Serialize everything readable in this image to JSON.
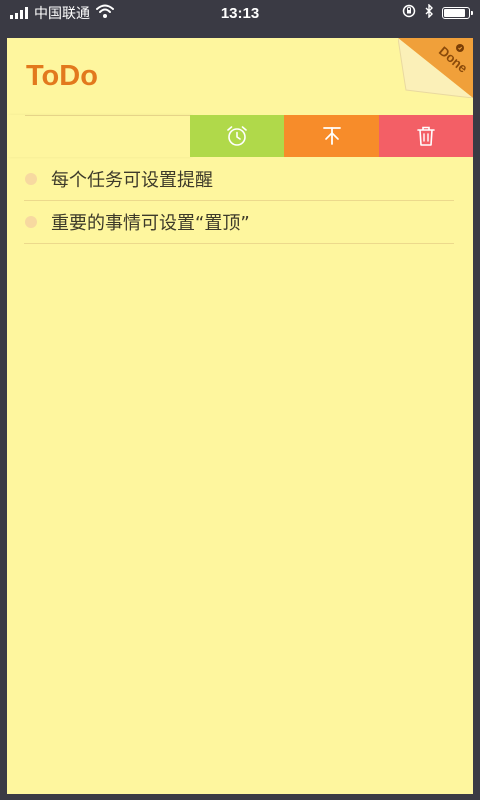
{
  "status_bar": {
    "carrier": "中国联通",
    "time": "13:13",
    "signal_icon": "signal-bars-icon",
    "wifi_icon": "wifi-icon",
    "orientation_lock_icon": "orientation-lock-icon",
    "bluetooth_icon": "bluetooth-icon",
    "battery_icon": "battery-icon"
  },
  "header": {
    "title": "ToDo",
    "done_label": "Done"
  },
  "swipe_actions": {
    "remind_icon": "alarm-clock-icon",
    "top_icon": "pin-to-top-icon",
    "delete_icon": "trash-icon"
  },
  "todos": [
    {
      "text": "每个任务可设置提醒"
    },
    {
      "text": "重要的事情可设置“置顶”"
    }
  ],
  "colors": {
    "background": "#fef69e",
    "title": "#e2791d",
    "remind": "#b0d94a",
    "top": "#f78c2a",
    "delete": "#f35f66",
    "bullet": "#f7d9a0"
  }
}
